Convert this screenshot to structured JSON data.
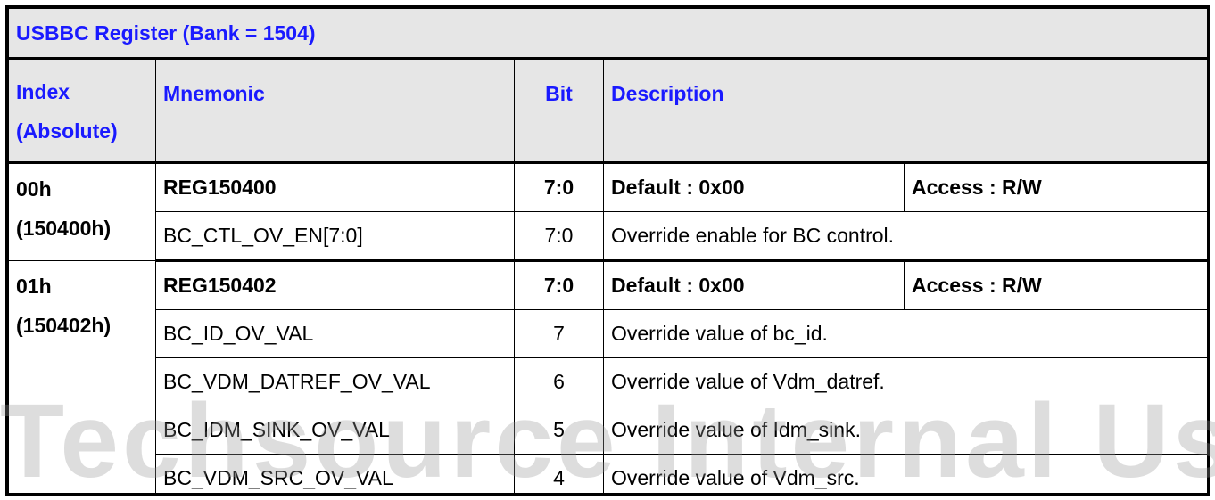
{
  "title": "USBBC Register (Bank = 1504)",
  "headers": {
    "index": "Index (Absolute)",
    "mnemonic": "Mnemonic",
    "bit": "Bit",
    "description": "Description"
  },
  "registers": [
    {
      "index": "00h",
      "absolute": "(150400h)",
      "name": "REG150400",
      "bits": "7:0",
      "default": "Default : 0x00",
      "access": "Access : R/W",
      "fields": [
        {
          "mnemonic": "BC_CTL_OV_EN[7:0]",
          "bit": "7:0",
          "description": "Override enable for BC control."
        }
      ]
    },
    {
      "index": "01h",
      "absolute": "(150402h)",
      "name": "REG150402",
      "bits": "7:0",
      "default": "Default : 0x00",
      "access": "Access : R/W",
      "fields": [
        {
          "mnemonic": "BC_ID_OV_VAL",
          "bit": "7",
          "description": "Override value of bc_id."
        },
        {
          "mnemonic": "BC_VDM_DATREF_OV_VAL",
          "bit": "6",
          "description": "Override value of Vdm_datref."
        },
        {
          "mnemonic": "BC_IDM_SINK_OV_VAL",
          "bit": "5",
          "description": "Override value of Idm_sink."
        },
        {
          "mnemonic": "BC_VDM_SRC_OV_VAL",
          "bit": "4",
          "description": "Override value of Vdm_src."
        }
      ]
    }
  ],
  "watermark": "Techsource Internal Use",
  "colors": {
    "header_text": "#1a1aff",
    "header_bg": "#e6e6e6"
  }
}
